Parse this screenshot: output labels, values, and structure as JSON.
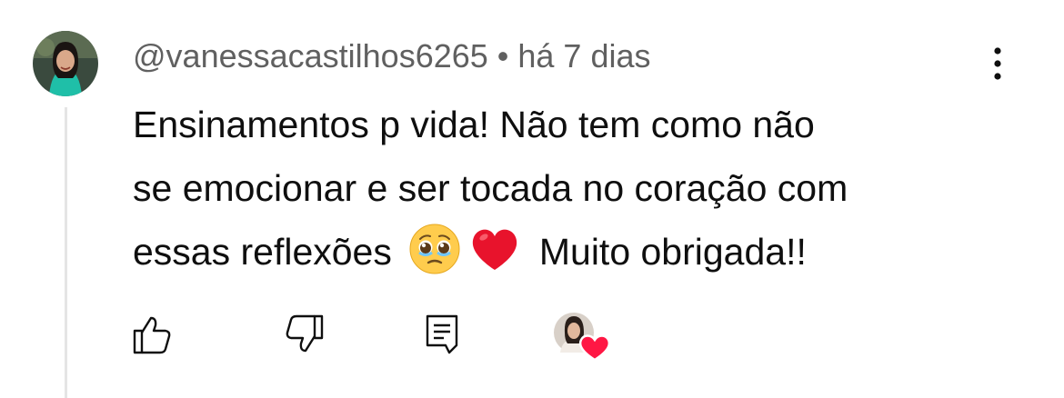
{
  "comment": {
    "author": "@vanessacastilhos6265",
    "separator": "•",
    "time": "há 7 dias",
    "text_line1": "Ensinamentos p vida! Não tem como não",
    "text_line2": "se emocionar e ser tocada no coração com",
    "text_line3_before": "essas reflexões",
    "text_line3_after": "Muito obrigada!!",
    "emojis": [
      "pleading-face",
      "red-heart"
    ]
  },
  "icons": {
    "menu": "more-vert-icon",
    "like": "thumb-up-icon",
    "dislike": "thumb-down-icon",
    "reply": "reply-comment-icon",
    "creator_heart": "creator-heart-icon"
  },
  "colors": {
    "text": "#0f0f0f",
    "meta": "#606060",
    "thread_line": "#e5e5e5",
    "heart": "#ff1744"
  }
}
